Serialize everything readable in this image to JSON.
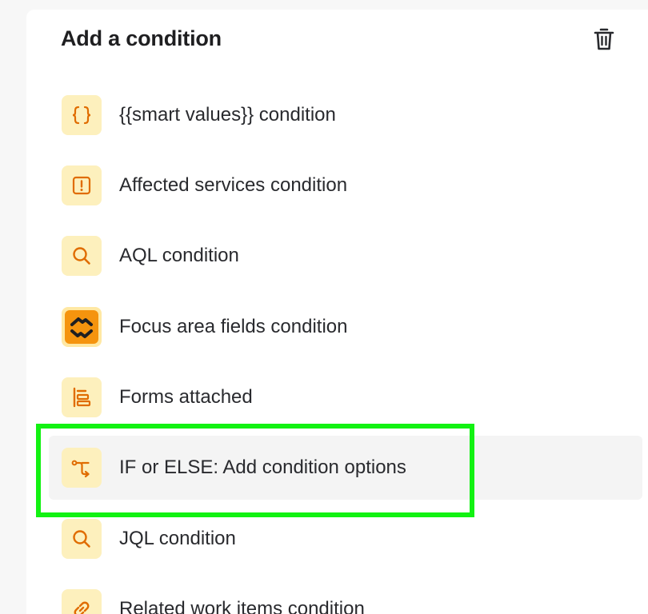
{
  "panel": {
    "title": "Add a condition",
    "delete_icon": "trash-icon"
  },
  "items": [
    {
      "label": "{{smart values}} condition",
      "icon": "curly-braces-icon"
    },
    {
      "label": "Affected services condition",
      "icon": "exclamation-square-icon"
    },
    {
      "label": "AQL condition",
      "icon": "search-icon"
    },
    {
      "label": "Focus area fields condition",
      "icon": "focus-area-icon"
    },
    {
      "label": "Forms attached",
      "icon": "form-lines-icon"
    },
    {
      "label": "IF or ELSE: Add condition options",
      "icon": "branch-icon",
      "state": "hovered"
    },
    {
      "label": "JQL condition",
      "icon": "search-icon"
    },
    {
      "label": "Related work items condition",
      "icon": "link-icon"
    }
  ],
  "colors": {
    "icon_tile_bg": "#fdf0bd",
    "icon_stroke": "#e06c00",
    "focus_area_bg": "#f5940e",
    "highlight": "#12f212"
  }
}
